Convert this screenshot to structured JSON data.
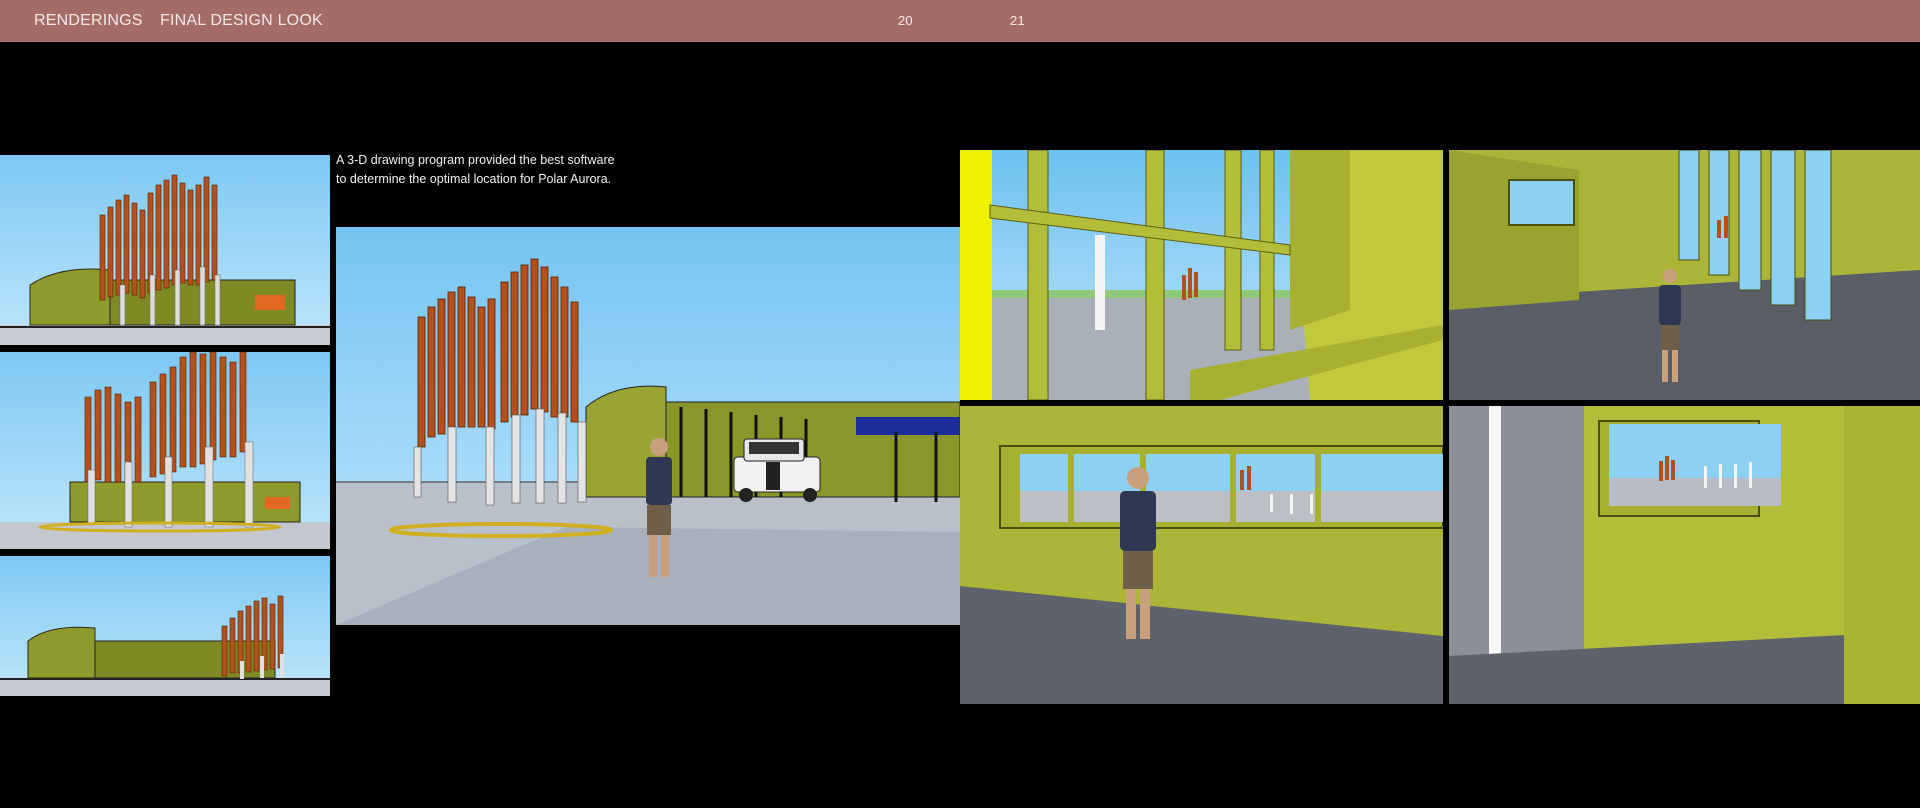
{
  "header": {
    "section": "RENDERINGS",
    "subsection": "FINAL DESIGN LOOK",
    "page_left": "20",
    "page_right": "21"
  },
  "caption": {
    "line1": "A 3-D drawing program provided the best software",
    "line2": "to determine the optimal location for Polar Aurora."
  },
  "colors": {
    "header_bg": "#a46c68",
    "page_bg": "#000000",
    "sky": "#7cc8f2",
    "sculpture": "#b4501c",
    "building": "#8e9a2c",
    "interior_wall": "#aeb63a"
  },
  "images": [
    {
      "name": "small-rendering-1",
      "subject": "exterior sculpture and building, distant view"
    },
    {
      "name": "small-rendering-2",
      "subject": "exterior sculpture, close view"
    },
    {
      "name": "small-rendering-3",
      "subject": "exterior building with sculpture at right"
    },
    {
      "name": "main-rendering",
      "subject": "person photographing sculpture beside white pickup truck"
    },
    {
      "name": "interior-rendering-1",
      "subject": "view through yellow beams toward sculpture"
    },
    {
      "name": "interior-rendering-2",
      "subject": "person photographing through tall windows"
    },
    {
      "name": "interior-rendering-3",
      "subject": "person photographing through long window"
    },
    {
      "name": "interior-rendering-4",
      "subject": "window view of sculpture and poles"
    }
  ]
}
